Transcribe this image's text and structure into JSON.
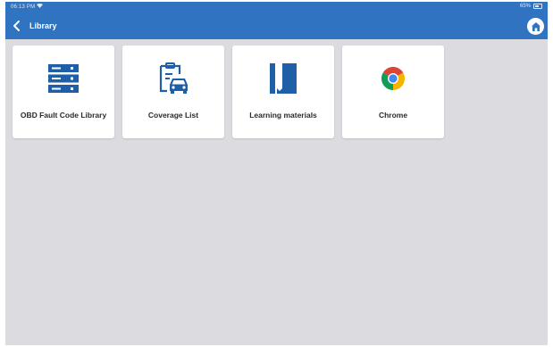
{
  "status_bar": {
    "time": "06:13 PM",
    "battery": "65%"
  },
  "header": {
    "title": "Library"
  },
  "colors": {
    "header_bg": "#2f73c1",
    "accent_blue": "#1f5fa8",
    "background": "#dcdbe0"
  },
  "tiles": [
    {
      "label": "OBD Fault Code Library",
      "icon": "server-database-icon"
    },
    {
      "label": "Coverage List",
      "icon": "clipboard-car-icon"
    },
    {
      "label": "Learning materials",
      "icon": "book-bookmark-icon"
    },
    {
      "label": "Chrome",
      "icon": "chrome-icon"
    }
  ]
}
